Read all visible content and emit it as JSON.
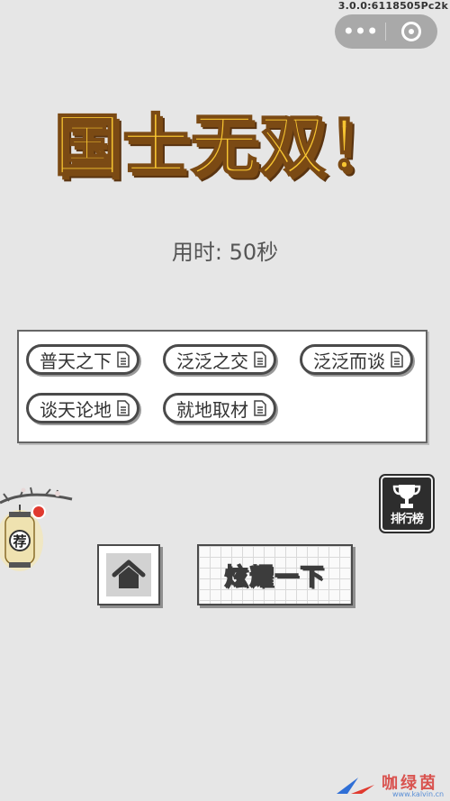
{
  "version": "3.0.0:6118505Pc2k",
  "capsule": {
    "more_icon": "more-dots",
    "close_icon": "target-circle"
  },
  "title": "国士无双！",
  "time_text": "用时: 50秒",
  "idioms": [
    "普天之下",
    "泛泛之交",
    "泛泛而谈",
    "谈天论地",
    "就地取材"
  ],
  "rank_label": "排行榜",
  "lantern_char": "荐",
  "home_icon": "home-icon",
  "share_label": "炫耀一下",
  "watermark": {
    "text": "咖绿茵",
    "url": "www.kalvin.cn"
  },
  "colors": {
    "title_fill": "#f7c531",
    "title_outline": "#7b4a14",
    "badge": "#e03a2f",
    "background": "#e6e6e6"
  }
}
